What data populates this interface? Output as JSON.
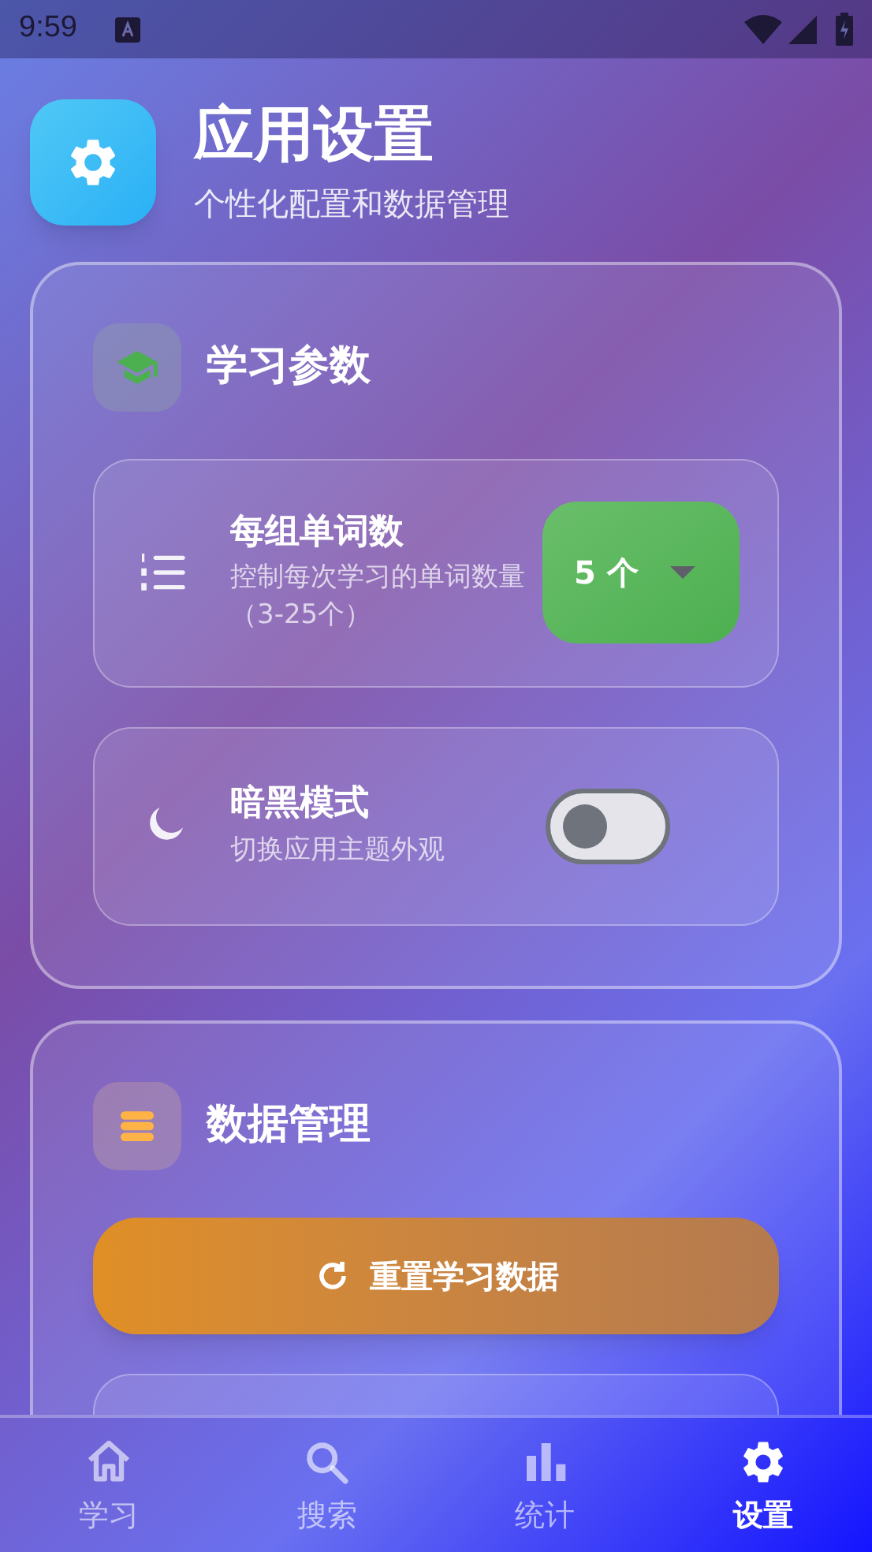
{
  "status_bar": {
    "time": "9:59"
  },
  "header": {
    "title": "应用设置",
    "subtitle": "个性化配置和数据管理"
  },
  "sections": [
    {
      "title": "学习参数",
      "settings": [
        {
          "kind": "dropdown",
          "title": "每组单词数",
          "description": "控制每次学习的单词数量（3-25个）",
          "value": "5 个"
        },
        {
          "kind": "toggle",
          "title": "暗黑模式",
          "description": "切换应用主题外观",
          "on": false
        }
      ]
    },
    {
      "title": "数据管理",
      "actions": [
        {
          "label": "重置学习数据"
        }
      ]
    }
  ],
  "nav": [
    {
      "label": "学习",
      "selected": false
    },
    {
      "label": "搜索",
      "selected": false
    },
    {
      "label": "统计",
      "selected": false
    },
    {
      "label": "设置",
      "selected": true
    }
  ]
}
